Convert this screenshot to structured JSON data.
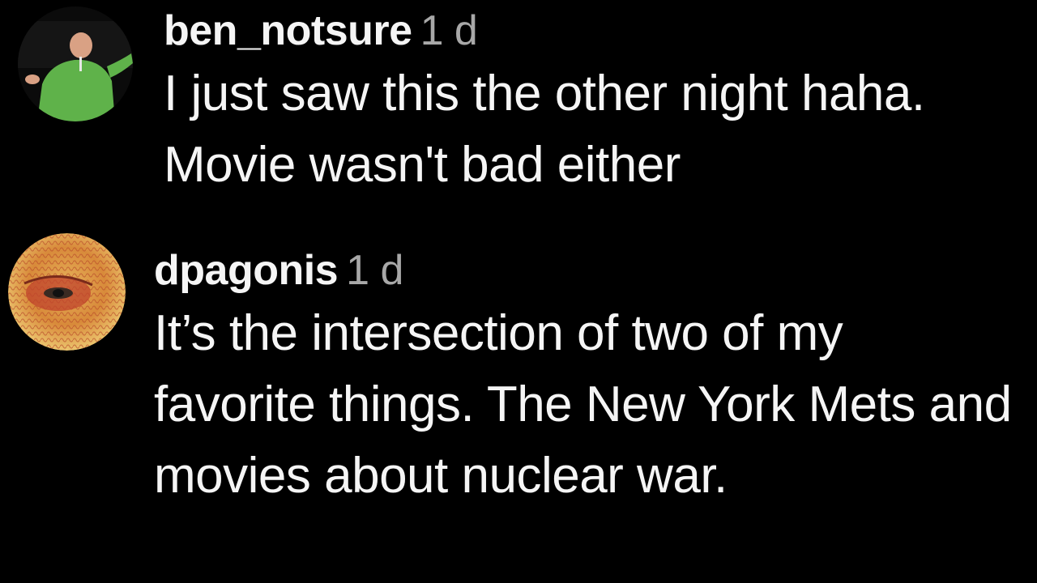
{
  "comments": [
    {
      "username": "ben_notsure",
      "timestamp": "1 d",
      "text": "I just saw this the other night haha. Movie wasn't bad either",
      "avatar_icon": "user-avatar-photo"
    },
    {
      "username": "dpagonis",
      "timestamp": "1 d",
      "text": "It’s the intersection of two of my favorite things. The New York Mets and movies about nuclear war.",
      "avatar_icon": "user-avatar-eye"
    }
  ],
  "colors": {
    "background": "#000000",
    "text": "#f5f5f5",
    "timestamp": "#a8a8a8"
  }
}
